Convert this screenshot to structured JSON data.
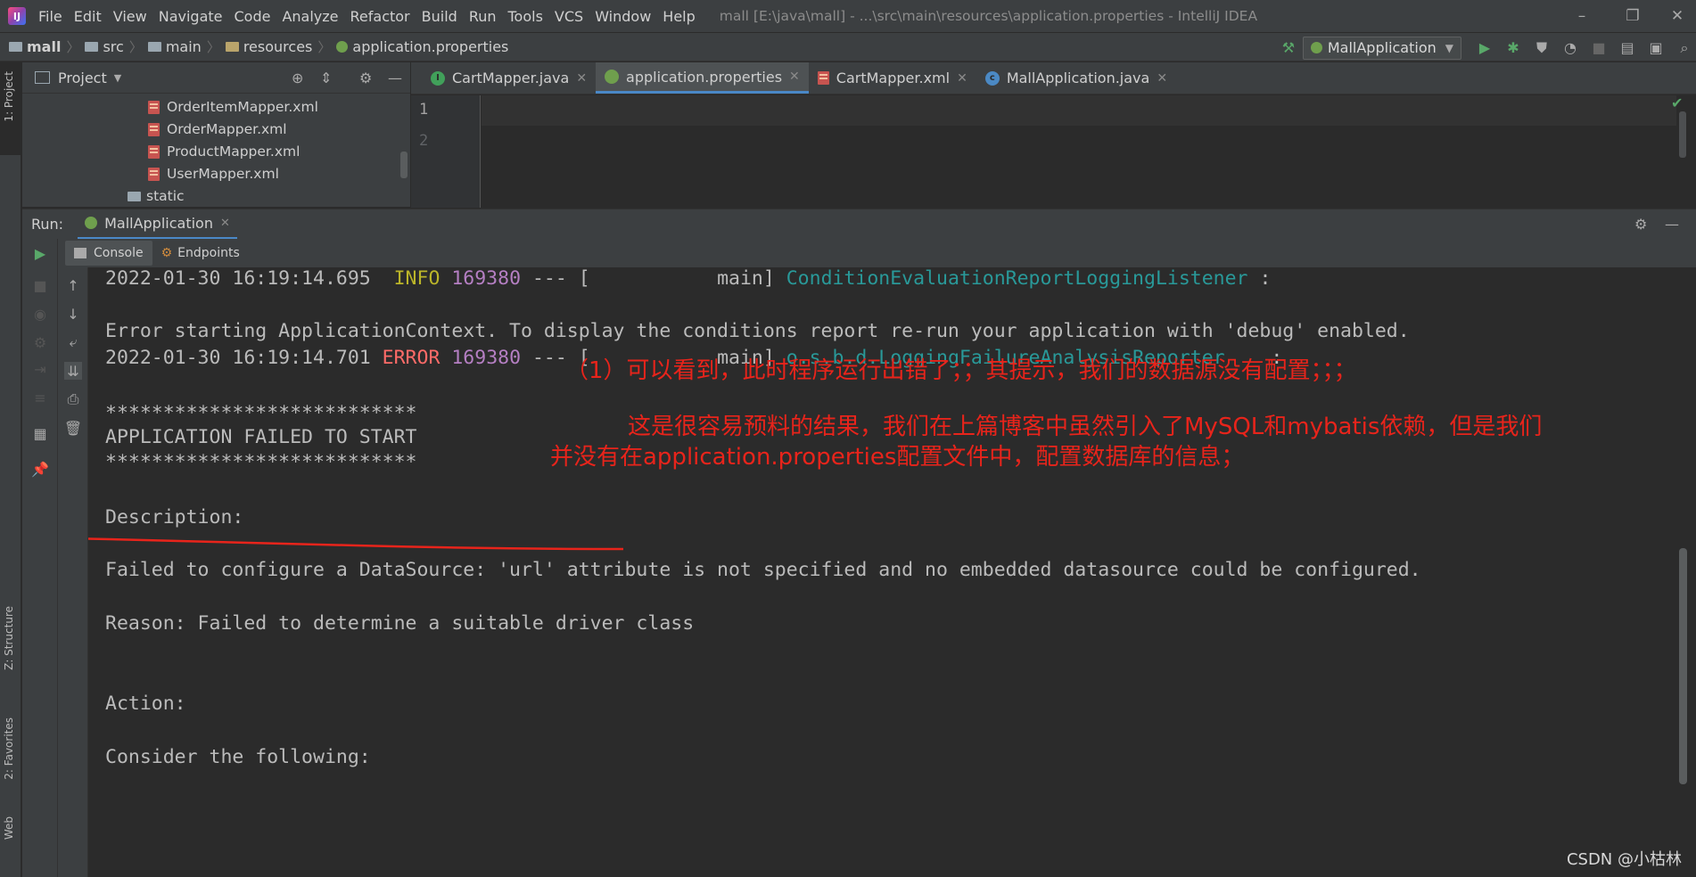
{
  "app": {
    "menu": [
      "File",
      "Edit",
      "View",
      "Navigate",
      "Code",
      "Analyze",
      "Refactor",
      "Build",
      "Run",
      "Tools",
      "VCS",
      "Window",
      "Help"
    ],
    "window_title": "mall [E:\\java\\mall] - ...\\src\\main\\resources\\application.properties - IntelliJ IDEA",
    "window_controls": {
      "minimize": "–",
      "restore": "❐",
      "close": "✕"
    }
  },
  "breadcrumb": {
    "items": [
      "mall",
      "src",
      "main",
      "resources",
      "application.properties"
    ]
  },
  "toolbar": {
    "run_config": "MallApplication"
  },
  "left_stripe": {
    "project": "1: Project",
    "structure": "Z: Structure",
    "favorites": "2: Favorites",
    "web": "Web"
  },
  "project_panel": {
    "title": "Project",
    "tree": [
      "OrderItemMapper.xml",
      "OrderMapper.xml",
      "ProductMapper.xml",
      "UserMapper.xml",
      "static"
    ]
  },
  "editor": {
    "tabs": [
      {
        "label": "CartMapper.java",
        "icon": "java-interface-icon"
      },
      {
        "label": "application.properties",
        "icon": "properties-icon",
        "active": true
      },
      {
        "label": "CartMapper.xml",
        "icon": "xml-icon"
      },
      {
        "label": "MallApplication.java",
        "icon": "java-class-icon"
      }
    ],
    "lines": [
      "1",
      "2"
    ]
  },
  "run_panel": {
    "label": "Run:",
    "tab": "MallApplication",
    "subtabs": [
      "Console",
      "Endpoints"
    ]
  },
  "console": {
    "line1": {
      "ts": "2022-01-30 16:19:14.695",
      "level": "INFO",
      "pid": "169380",
      "mid": " --- [           main] ",
      "logger": "ConditionEvaluationReportLoggingListener",
      "tail": " :"
    },
    "line2": "Error starting ApplicationContext. To display the conditions report re-run your application with 'debug' enabled.",
    "line3": {
      "ts": "2022-01-30 16:19:14.701",
      "level": "ERROR",
      "pid": "169380",
      "mid": " --- [           main] ",
      "logger": "o.s.b.d.LoggingFailureAnalysisReporter",
      "tail": "    :"
    },
    "stars1": "***************************",
    "failed": "APPLICATION FAILED TO START",
    "stars2": "***************************",
    "description": "Description:",
    "failed_config": "Failed to configure a DataSource: 'url' attribute is not specified and no embedded datasource could be configured.",
    "reason": "Reason: Failed to determine a suitable driver class",
    "action": "Action:",
    "consider": "Consider the following:"
  },
  "annotations": {
    "note1": "（1）可以看到，此时程序运行出错了；；其提示，我们的数据源没有配置；；；",
    "note2": "这是很容易预料的结果，我们在上篇博客中虽然引入了MySQL和mybatis依赖，但是我们",
    "note3": "并没有在application.properties配置文件中，配置数据库的信息；",
    "watermark": "CSDN @小枯林"
  },
  "colors": {
    "info": "#bbb529",
    "error": "#ff6b68",
    "pid": "#b57fc3",
    "logger": "#299999",
    "annotation": "#e8241b"
  }
}
